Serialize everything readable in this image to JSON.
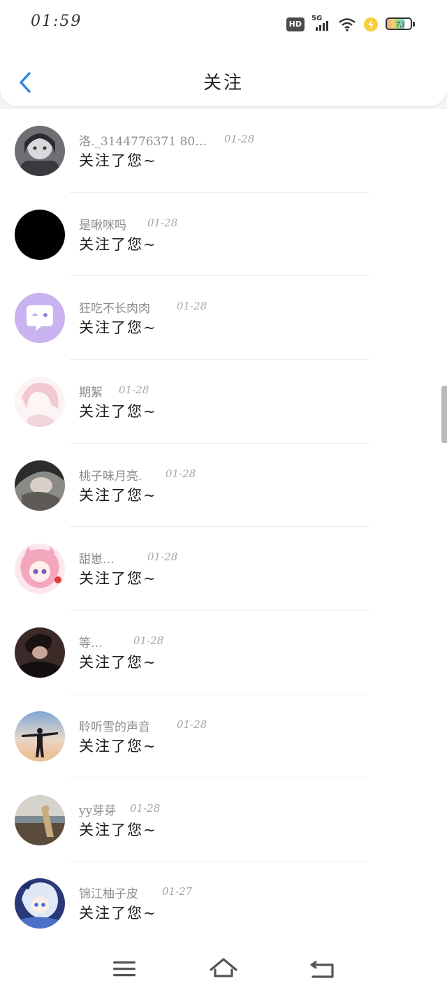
{
  "status_bar": {
    "time": "01:59",
    "hd": "HD",
    "network": "5G",
    "battery_level": "73",
    "icons": [
      "hd-icon",
      "signal-5g-icon",
      "wifi-icon",
      "charging-icon",
      "battery-icon"
    ]
  },
  "header": {
    "back_icon": "chevron-left-icon",
    "title": "关注"
  },
  "colors": {
    "accent": "#2f86e6",
    "page_bg": "#f4f4f6",
    "name_text": "#8c8c8c",
    "message_text": "#1b1b1b"
  },
  "list": {
    "items": [
      {
        "name": "洛._3144776371 80…",
        "date": "01-28",
        "message": "关注了您~"
      },
      {
        "name": "是啾咪吗",
        "date": "01-28",
        "message": "关注了您~"
      },
      {
        "name": "狂吃不长肉肉",
        "date": "01-28",
        "message": "关注了您~"
      },
      {
        "name": "期絮",
        "date": "01-28",
        "message": "关注了您~"
      },
      {
        "name": "桃子味月亮.",
        "date": "01-28",
        "message": "关注了您~"
      },
      {
        "name": "甜崽…",
        "date": "01-28",
        "message": "关注了您~"
      },
      {
        "name": "等…",
        "date": "01-28",
        "message": "关注了您~"
      },
      {
        "name": "聆听雪的声音",
        "date": "01-28",
        "message": "关注了您~"
      },
      {
        "name": "yy芽芽",
        "date": "01-28",
        "message": "关注了您~"
      },
      {
        "name": "锦江柚子皮",
        "date": "01-27",
        "message": "关注了您~"
      }
    ]
  },
  "nav_bar": {
    "icons": [
      "menu-icon",
      "home-icon",
      "back-icon"
    ]
  }
}
